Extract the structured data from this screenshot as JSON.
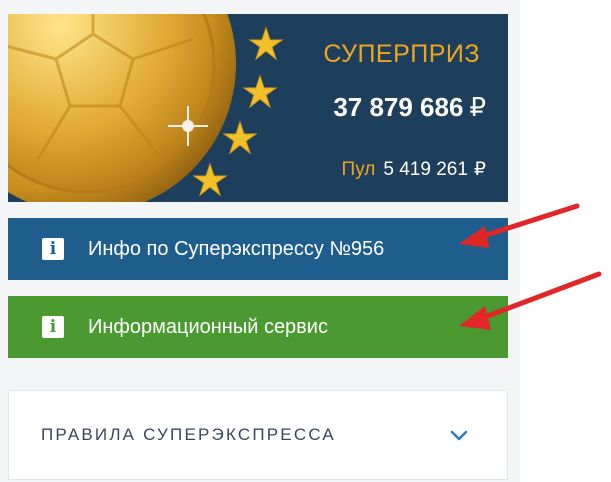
{
  "banner": {
    "title": "СУПЕРПРИЗ",
    "amount": "37 879 686",
    "currency": "₽",
    "pool_label": "Пул",
    "pool_amount": "5 419 261",
    "pool_currency": "₽"
  },
  "info_buttons": [
    {
      "label": "Инфо по Суперэкспрессу №956",
      "icon": "info-icon",
      "color": "#1f5d8d"
    },
    {
      "label": "Информационный сервис",
      "icon": "info-icon",
      "color": "#4a9a31"
    }
  ],
  "info_icon_glyph": "i",
  "rules": {
    "label": "ПРАВИЛА СУПЕРЭКСПРЕССА",
    "icon": "chevron-down-icon"
  },
  "colors": {
    "banner_bg": "#1d3f5c",
    "accent_orange": "#f0a51e",
    "annotation_arrow": "#e02626"
  }
}
